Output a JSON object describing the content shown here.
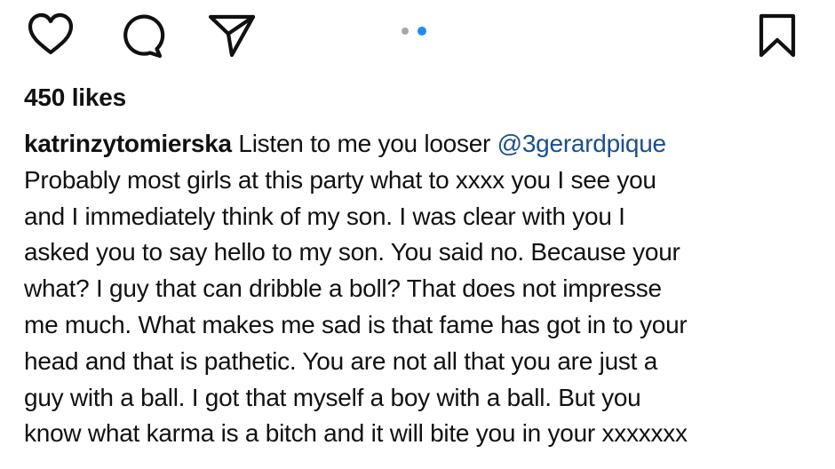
{
  "colors": {
    "icon": "#111111",
    "dot_inactive": "#a8a8a8",
    "dot_active": "#1d8cf2",
    "mention": "#1a4f8f",
    "text": "#111111",
    "background": "#ffffff"
  },
  "actions": {
    "like_icon": "heart-outline",
    "comment_icon": "speech-bubble-outline",
    "share_icon": "paper-plane-outline",
    "save_icon": "bookmark-outline"
  },
  "carousel": {
    "total": 2,
    "active": 2
  },
  "post": {
    "likes": "450 likes",
    "username": "katrinzytomierska",
    "caption_first": "Listen to me you looser ",
    "mention": "@3gerardpique",
    "caption_lines": [
      "Probably most girls at this party what to xxxx you I see you",
      "and I immediately think of my son. I was clear with you I",
      "asked you to say hello to my son. You said no. Because your",
      "what? I guy that can dribble a boll? That does not impresse",
      "me much. What makes me sad is that fame has got in to your",
      "head and that is pathetic. You are not all that you are just a",
      "guy with a ball. I got that myself a boy with a ball. But you",
      "know what karma is a bitch and it will bite you in your xxxxxxx"
    ]
  }
}
